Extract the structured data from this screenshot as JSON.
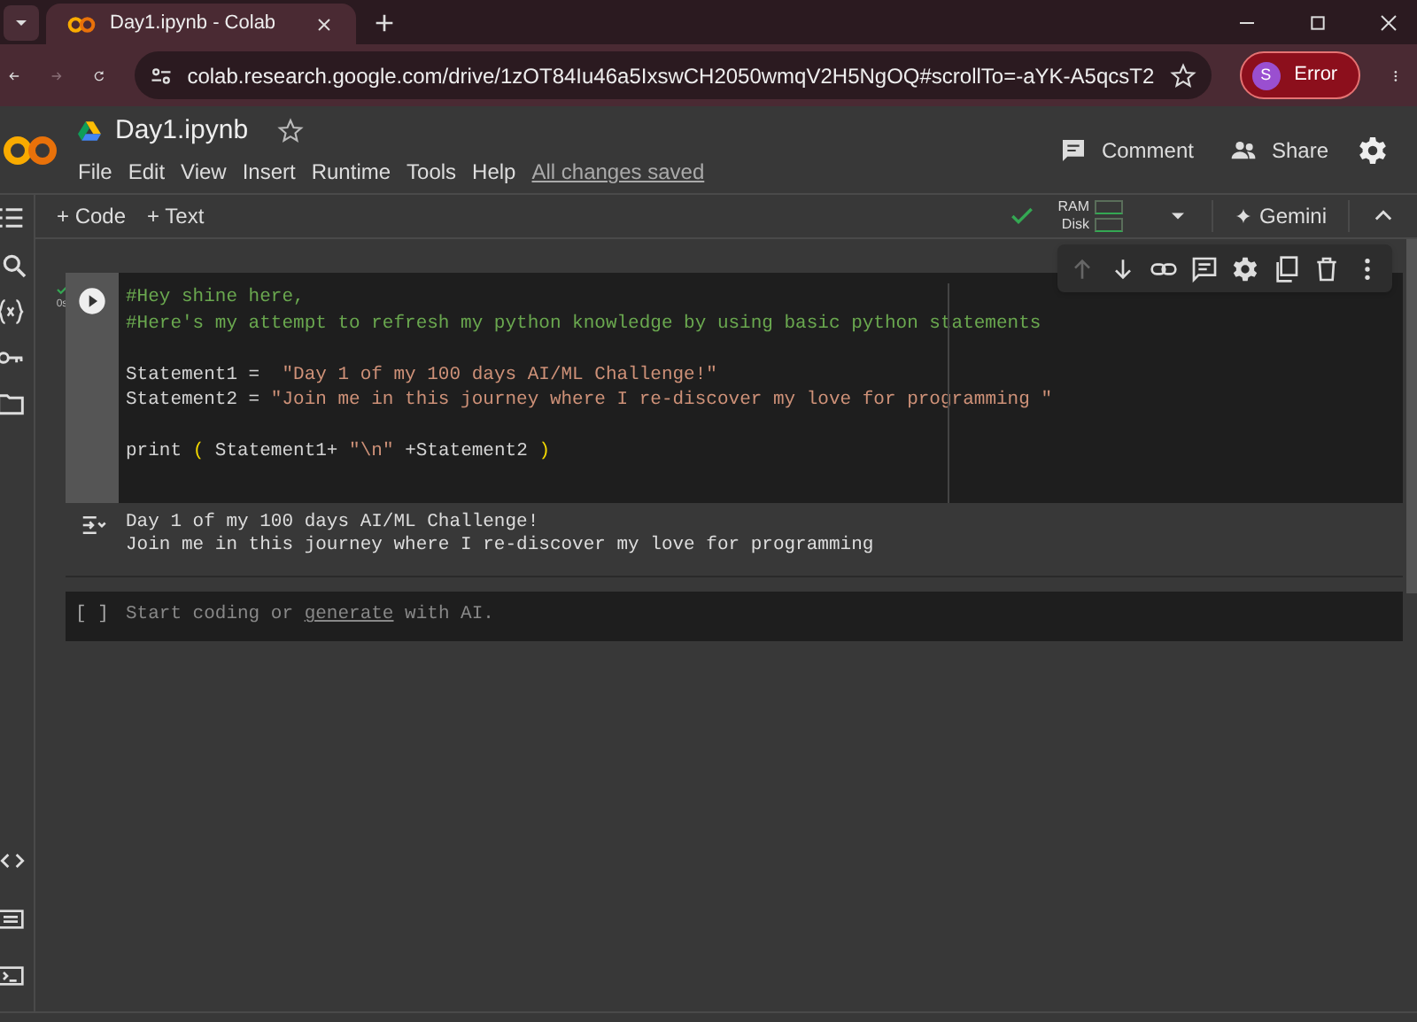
{
  "browser": {
    "tab_title": "Day1.ipynb - Colab",
    "url": "colab.research.google.com/drive/1zOT84Iu46a5IxswCH2050wmqV2H5NgOQ#scrollTo=-aYK-A5qcsT2",
    "profile_initial": "S",
    "profile_status": "Error"
  },
  "notebook": {
    "title": "Day1.ipynb",
    "menu": [
      "File",
      "Edit",
      "View",
      "Insert",
      "Runtime",
      "Tools",
      "Help"
    ],
    "save_status": "All changes saved",
    "actions": [
      "Comment",
      "Share"
    ]
  },
  "toolbar": {
    "add_buttons": [
      "+ Code",
      "+ Text"
    ],
    "resources": [
      "RAM",
      "Disk"
    ],
    "gemini": "Gemini"
  },
  "cell": {
    "exec_time": "0s",
    "lines": [
      {
        "gap_before": false,
        "segments": [
          {
            "kind": "comment",
            "text": "#Hey shine here,"
          }
        ]
      },
      {
        "gap_before": false,
        "segments": [
          {
            "kind": "comment",
            "text": "#Here's my attempt to refresh my python knowledge by using basic python statements"
          }
        ]
      },
      {
        "gap_before": true,
        "segments": [
          {
            "kind": "plain",
            "text": "Statement1 =  "
          },
          {
            "kind": "string",
            "text": "\"Day 1 of my 100 days AI/ML Challenge!\""
          }
        ]
      },
      {
        "gap_before": false,
        "segments": [
          {
            "kind": "plain",
            "text": "Statement2 = "
          },
          {
            "kind": "string",
            "text": "\"Join me in this journey where I re-discover my love for programming \""
          }
        ]
      },
      {
        "gap_before": true,
        "segments": [
          {
            "kind": "plain",
            "text": "print "
          },
          {
            "kind": "paren",
            "text": "("
          },
          {
            "kind": "plain",
            "text": " Statement1+ "
          },
          {
            "kind": "string",
            "text": "\"\\n\""
          },
          {
            "kind": "plain",
            "text": " +Statement2 "
          },
          {
            "kind": "paren",
            "text": ")"
          }
        ]
      }
    ],
    "output": [
      "Day 1 of my 100 days AI/ML Challenge!",
      "Join me in this journey where I re-discover my love for programming"
    ]
  },
  "empty_cell": {
    "brackets": "[ ]",
    "placeholder_before": "Start coding or ",
    "placeholder_link": "generate",
    "placeholder_after": " with AI."
  }
}
